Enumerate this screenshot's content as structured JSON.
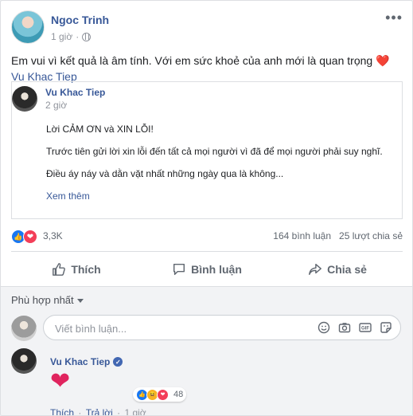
{
  "post": {
    "author": "Ngoc Trinh",
    "time": "1 giờ",
    "text": "Em vui vì kết quả là âm tính. Với em sức khoẻ của anh mới là quan trọng",
    "heart": "❤️",
    "mention": "Vu Khac Tiep",
    "more_icon": "•••"
  },
  "shared_post": {
    "author": "Vu Khac Tiep",
    "time": "2 giờ",
    "lines": [
      "Lời CẢM ƠN và XIN LỖI!",
      "Trước tiên gửi lời xin lỗi đến tất cả mọi người vì đã để mọi người phải suy nghĩ.",
      "Điều áy náy và dằn vặt nhất những ngày qua là không..."
    ],
    "see_more": "Xem thêm"
  },
  "reactions": {
    "count": "3,3K",
    "comments": "164 bình luận",
    "shares": "25 lượt chia sẻ",
    "icons": [
      "like-icon",
      "love-icon"
    ]
  },
  "actions": {
    "like": "Thích",
    "comment": "Bình luận",
    "share": "Chia sẻ"
  },
  "comments": {
    "sort_label": "Phù hợp nhất",
    "input_placeholder": "Viết bình luận...",
    "input_icons": [
      "emoji-icon",
      "camera-icon",
      "gif-icon",
      "sticker-icon"
    ],
    "items": [
      {
        "author": "Vu Khac Tiep",
        "verified": true,
        "content": "❤",
        "reaction_count": "48",
        "like_label": "Thích",
        "reply_label": "Trả lời",
        "time": "1 giờ"
      }
    ]
  },
  "colors": {
    "link": "#385898",
    "muted": "#90949c",
    "like": "#1877f2",
    "love": "#f33e58",
    "heart": "#e0245e"
  }
}
